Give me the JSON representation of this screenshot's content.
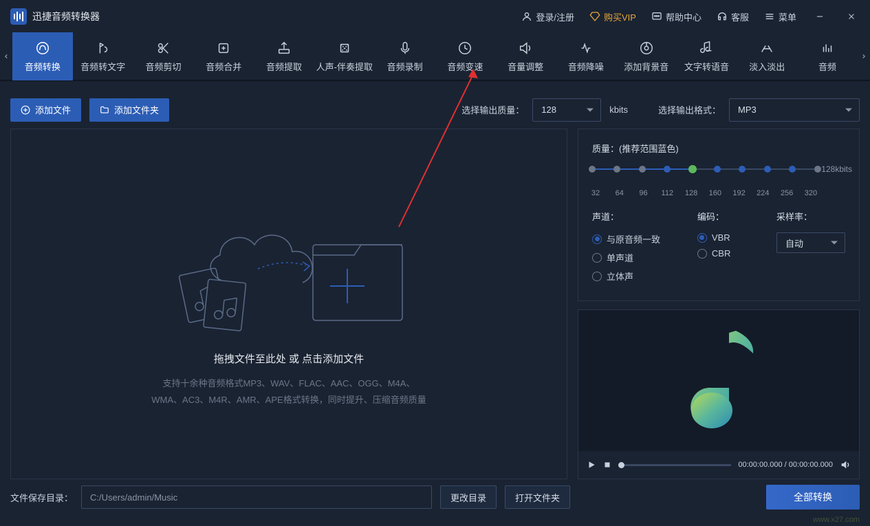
{
  "app": {
    "title": "迅捷音频转换器"
  },
  "titlebar": {
    "login": "登录/注册",
    "vip": "购买VIP",
    "help": "帮助中心",
    "service": "客服",
    "menu": "菜单"
  },
  "toolbar": {
    "items": [
      "音频转换",
      "音频转文字",
      "音频剪切",
      "音频合并",
      "音频提取",
      "人声-伴奏提取",
      "音频录制",
      "音频变速",
      "音量调整",
      "音频降噪",
      "添加背景音",
      "文字转语音",
      "淡入淡出",
      "音频"
    ],
    "activeIndex": 0
  },
  "actions": {
    "addFile": "添加文件",
    "addFolder": "添加文件夹",
    "qualityLabel": "选择输出质量：",
    "qualityValue": "128",
    "qualityUnit": "kbits",
    "formatLabel": "选择输出格式：",
    "formatValue": "MP3"
  },
  "drop": {
    "main": "拖拽文件至此处 或 点击添加文件",
    "desc1": "支持十余种音频格式MP3、WAV、FLAC、AAC、OGG、M4A、",
    "desc2": "WMA、AC3、M4R、AMR、APE格式转换，同时提升、压缩音频质量"
  },
  "settings": {
    "qualityTitle": "质量：(推荐范围蓝色)",
    "qualityCurrent": "128kbits",
    "ticks": [
      "32",
      "64",
      "96",
      "112",
      "128",
      "160",
      "192",
      "224",
      "256",
      "320"
    ],
    "channelTitle": "声道：",
    "channels": [
      "与原音频一致",
      "单声道",
      "立体声"
    ],
    "channelSelected": 0,
    "encodeTitle": "编码：",
    "encodes": [
      "VBR",
      "CBR"
    ],
    "encodeSelected": 0,
    "sampleTitle": "采样率：",
    "sampleValue": "自动"
  },
  "player": {
    "time": "00:00:00.000 / 00:00:00.000"
  },
  "bottom": {
    "pathLabel": "文件保存目录：",
    "path": "C:/Users/admin/Music",
    "changeDir": "更改目录",
    "openDir": "打开文件夹",
    "convertAll": "全部转换"
  },
  "watermark": {
    "line1": "",
    "line2": "www.x27.com"
  }
}
